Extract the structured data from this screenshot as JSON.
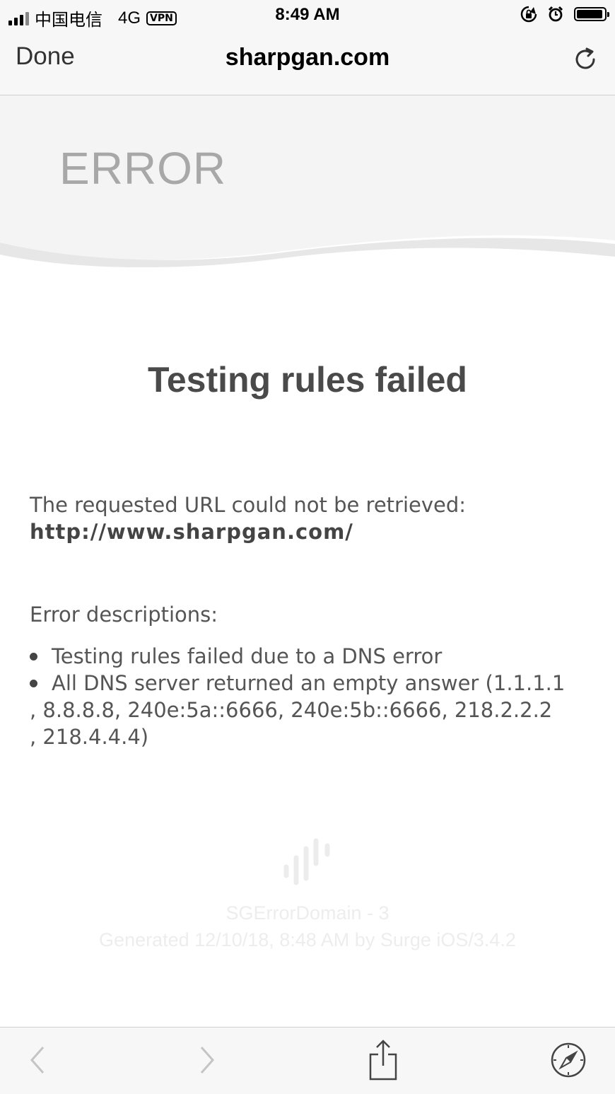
{
  "status_bar": {
    "carrier": "中国电信",
    "network": "4G",
    "vpn": "VPN",
    "time": "8:49 AM"
  },
  "nav": {
    "done_label": "Done",
    "title": "sharpgan.com"
  },
  "header": {
    "error_label": "ERROR"
  },
  "main": {
    "title": "Testing rules failed",
    "requested_url_label": "The requested URL could not be retrieved:",
    "requested_url": "http://www.sharpgan.com/",
    "descriptions_label": "Error descriptions:",
    "descriptions": [
      "Testing rules failed due to a DNS error",
      "All DNS server returned an empty answer (1.1.1.1",
      ", 8.8.8.8, 240e:5a::6666, 240e:5b::6666, 218.2.2.2",
      ", 218.4.4.4)"
    ]
  },
  "footer": {
    "domain": "SGErrorDomain - 3",
    "generated": "Generated 12/10/18, 8:48 AM by Surge iOS/3.4.2"
  },
  "colors": {
    "logo_blue": "#4a90e2",
    "logo_purple": "#b36bf0"
  }
}
